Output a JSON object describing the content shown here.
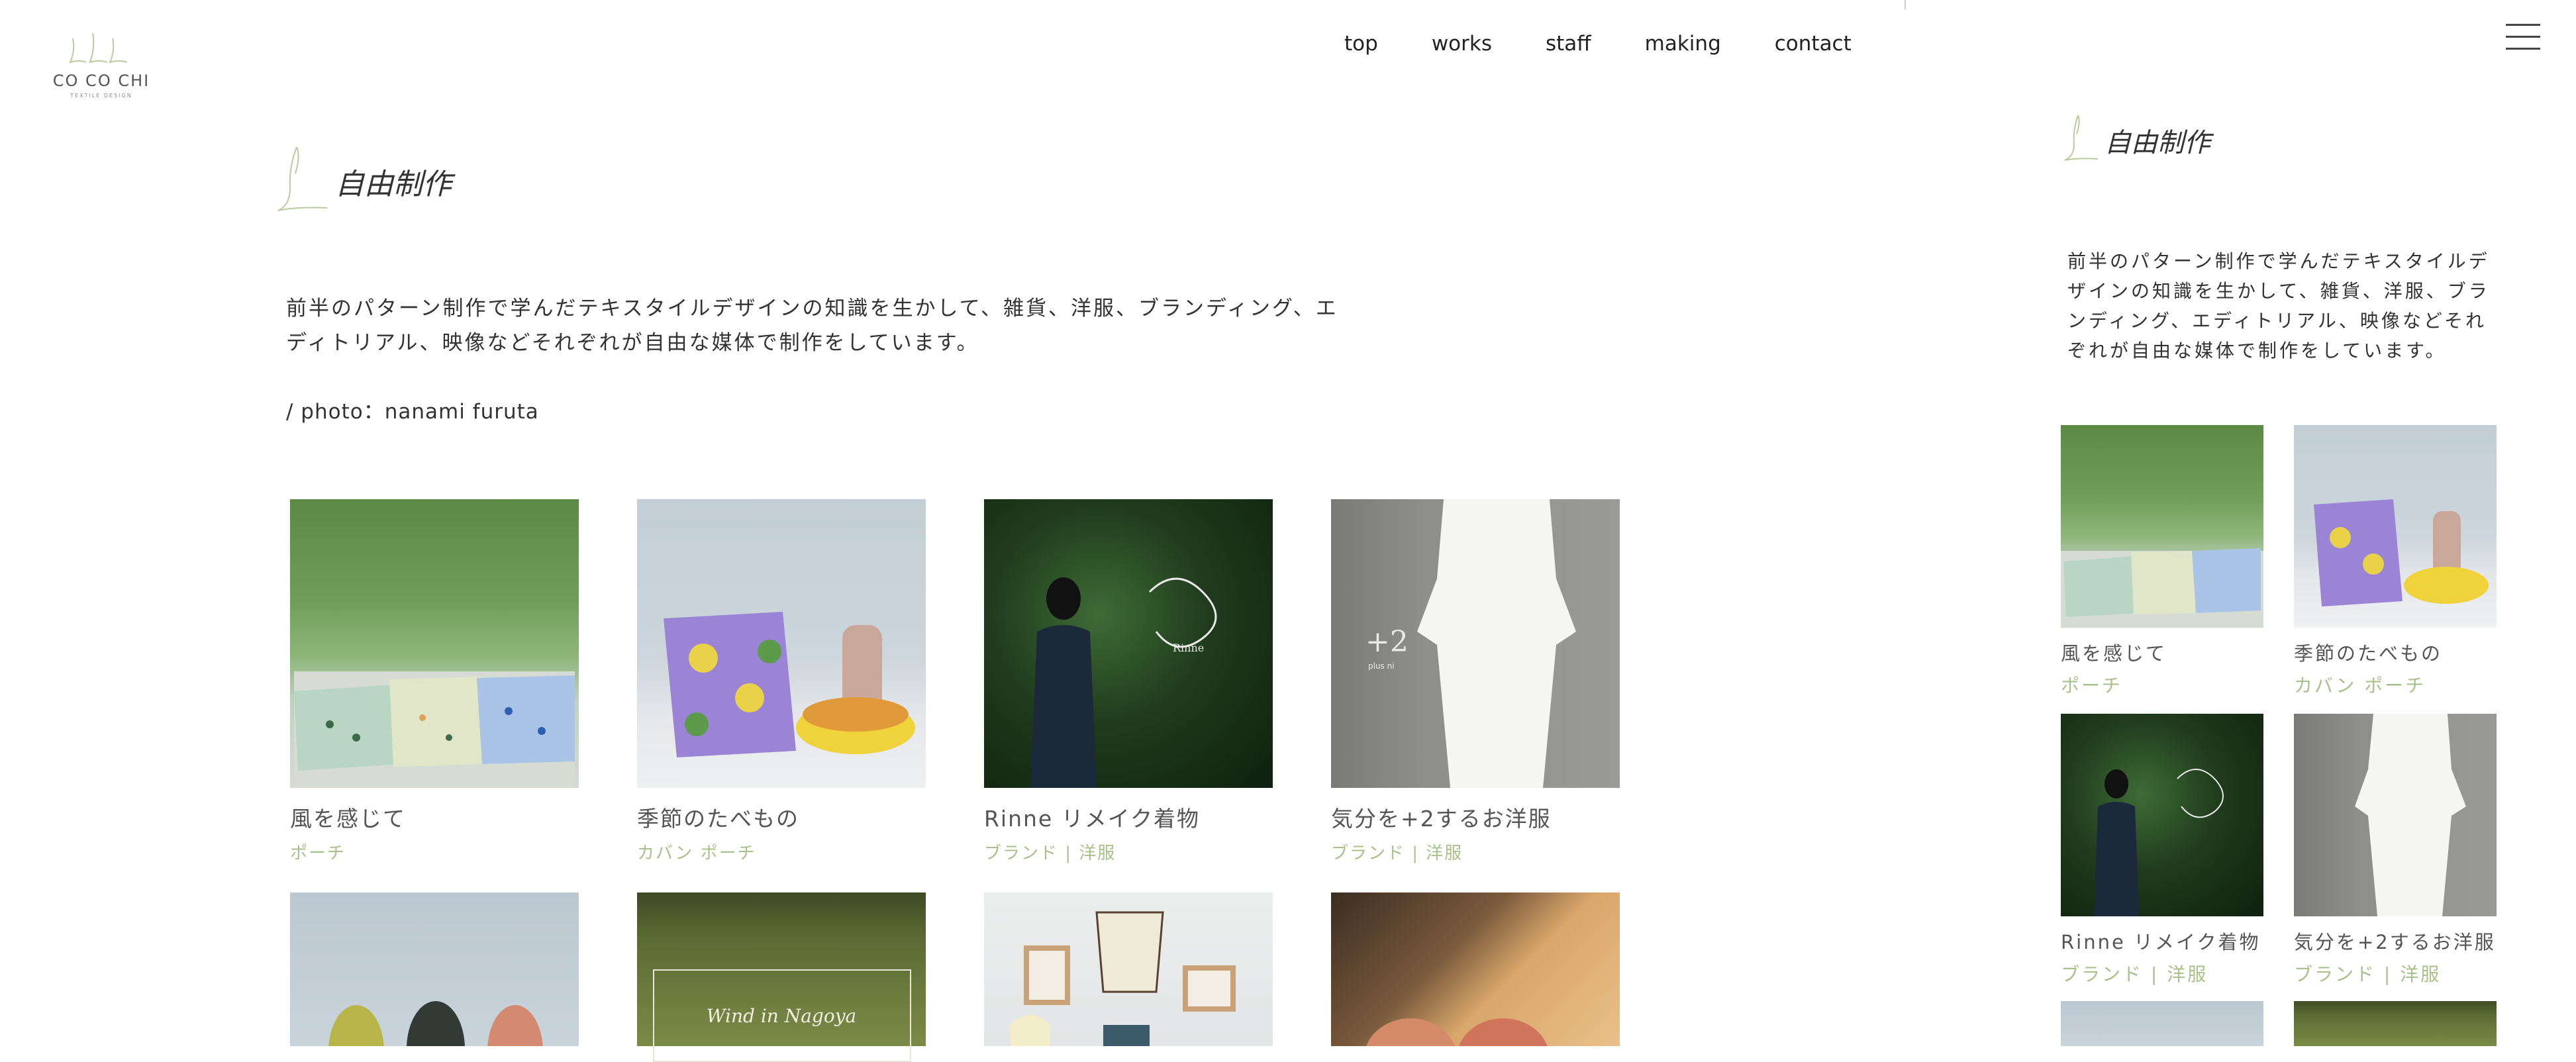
{
  "logo": {
    "text": "CO CO CHI",
    "subtext": "TEXTILE DESIGN"
  },
  "nav": [
    "top",
    "works",
    "staff",
    "making",
    "contact"
  ],
  "main": {
    "title": "自由制作",
    "description": "前半のパターン制作で学んだテキスタイルデザインの知識を生かして、雑貨、洋服、ブランディング、エディトリアル、映像などそれぞれが自由な媒体で制作をしています。",
    "credit": "/ photo：nanami furuta",
    "cards": [
      {
        "title": "風を感じて",
        "tag": "ポーチ"
      },
      {
        "title": "季節のたべもの",
        "tag": "カバン ポーチ"
      },
      {
        "title": "Rinne リメイク着物",
        "tag": "ブランド | 洋服"
      },
      {
        "title": "気分を+2するお洋服",
        "tag": "ブランド | 洋服"
      }
    ],
    "row2_captions": {
      "wind": "Wind in Nagoya"
    }
  },
  "side": {
    "title": "自由制作",
    "description": "前半のパターン制作で学んだテキスタイルデザインの知識を生かして、雑貨、洋服、ブランディング、エディトリアル、映像などそれぞれが自由な媒体で制作をしています。",
    "cards": [
      {
        "title": "風を感じて",
        "tag": "ポーチ"
      },
      {
        "title": "季節のたべもの",
        "tag": "カバン ポーチ"
      },
      {
        "title": "Rinne リメイク着物",
        "tag": "ブランド | 洋服"
      },
      {
        "title": "気分を+2するお洋服",
        "tag": "ブランド | 洋服"
      }
    ]
  },
  "photo_labels": {
    "rinne": "Rinne",
    "plus2": "+2",
    "plus2_sub": "plus ni"
  },
  "colors": {
    "accent": "#a9c18a",
    "text": "#333333"
  },
  "icons": {
    "menu": "hamburger-icon",
    "title_mark": "script-l-icon"
  }
}
